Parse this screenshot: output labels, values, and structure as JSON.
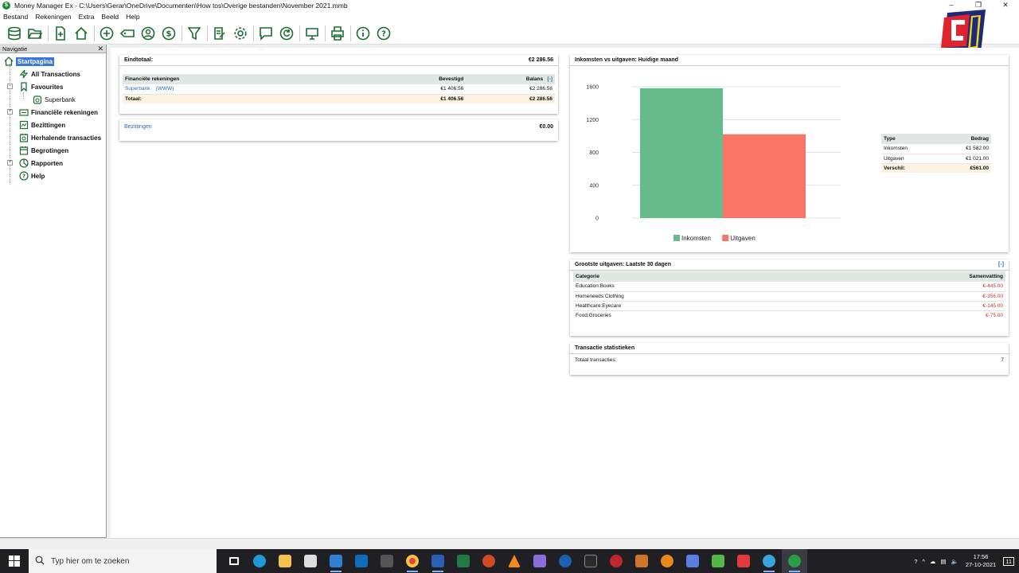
{
  "window": {
    "title": "Money Manager Ex - C:\\Users\\Gerar\\OneDrive\\Documenten\\How tos\\Overige bestanden\\November 2021.mmb"
  },
  "menu": [
    "Bestand",
    "Rekeningen",
    "Extra",
    "Beeld",
    "Help"
  ],
  "nav": {
    "title": "Navigatie",
    "items": {
      "home": "Startpagina",
      "all": "All Transactions",
      "fav": "Favourites",
      "superbank": "Superbank",
      "fin": "Financiële rekeningen",
      "assets": "Bezittingen",
      "recurring": "Herhalende transacties",
      "budgets": "Begrotingen",
      "reports": "Rapporten",
      "help": "Help"
    }
  },
  "summary": {
    "total_label": "Eindtotaal:",
    "total_value": "€2 286.56",
    "cols": {
      "name": "Financiële rekeningen",
      "confirmed": "Bevestigd",
      "balance": "Balans",
      "toggle": "[-]"
    },
    "row": {
      "name": "Superbank",
      "tag": "(WWW)",
      "confirmed": "€1 406.56",
      "balance": "€2 286.56"
    },
    "totals": {
      "label": "Totaal:",
      "confirmed": "€1 406.56",
      "balance": "€2 286.56"
    }
  },
  "assets": {
    "label": "Bezittingen",
    "value": "€0.00"
  },
  "income_chart": {
    "header": "Inkomsten vs uitgaven: Huidige maand",
    "table": {
      "col_type": "Type",
      "col_amount": "Bedrag",
      "rows": [
        {
          "type": "Inkomsten",
          "amount": "€1 582.00"
        },
        {
          "type": "Uitgaven",
          "amount": "€1 021.00"
        }
      ],
      "diff_label": "Verschil:",
      "diff_value": "€561.00"
    }
  },
  "chart_data": {
    "type": "bar",
    "categories": [
      "Inkomsten",
      "Uitgaven"
    ],
    "series": [
      {
        "name": "Inkomsten",
        "values": [
          1582
        ],
        "color": "#66bb8a"
      },
      {
        "name": "Uitgaven",
        "values": [
          1021
        ],
        "color": "#f87568"
      }
    ],
    "ylim": [
      0,
      1600
    ],
    "yticks": [
      "0",
      "400",
      "800",
      "1200",
      "1600"
    ],
    "grid": true,
    "legend": "bottom"
  },
  "expenses": {
    "header": "Grootste uitgaven: Laatste 30 dagen",
    "toggle": "[-]",
    "col_cat": "Categorie",
    "col_sum": "Samenvatting",
    "rows": [
      {
        "cat": "Education:Books",
        "sum": "€-445.00"
      },
      {
        "cat": "Homeneeds:Clothing",
        "sum": "€-356.00"
      },
      {
        "cat": "Healthcare:Eyecare",
        "sum": "€-145.00"
      },
      {
        "cat": "Food:Groceries",
        "sum": "€-75.00"
      }
    ]
  },
  "stats": {
    "header": "Transactie statistieken",
    "label": "Totaal transacties:",
    "value": "7"
  },
  "taskbar": {
    "search_placeholder": "Typ hier om te zoeken",
    "time": "17:56",
    "date": "27-10-2021",
    "notif_count": "11"
  },
  "colors": {
    "income": "#66bb8a",
    "expense": "#f87568",
    "accent": "#1a6e30",
    "selection": "#3a78d8"
  }
}
